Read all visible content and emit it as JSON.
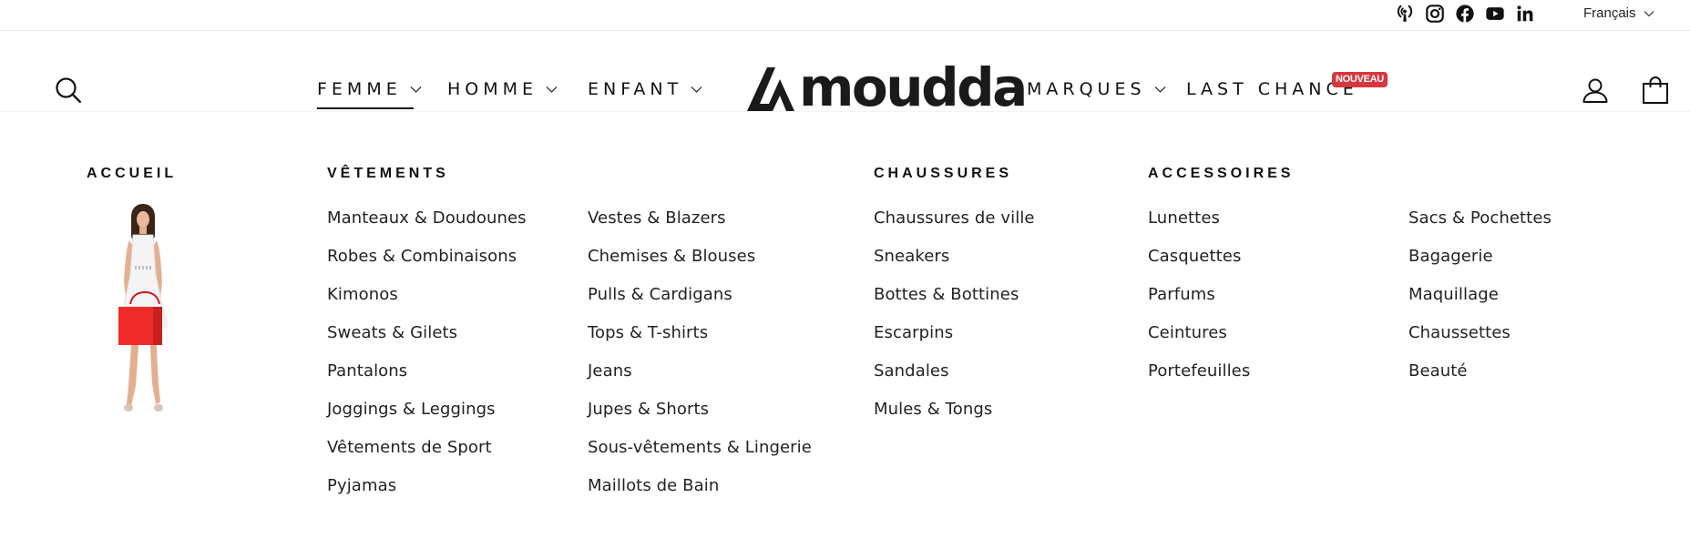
{
  "topbar": {
    "socials": [
      {
        "icon": "podcast-icon",
        "label": "Podcast"
      },
      {
        "icon": "instagram-icon",
        "label": "Instagram"
      },
      {
        "icon": "facebook-icon",
        "label": "Facebook"
      },
      {
        "icon": "youtube-icon",
        "label": "YouTube"
      },
      {
        "icon": "linkedin-icon",
        "label": "LinkedIn"
      }
    ],
    "language": "Français"
  },
  "header": {
    "logo_text": "moudda",
    "nav": [
      {
        "label": "FEMME",
        "active": true
      },
      {
        "label": "HOMME"
      },
      {
        "label": "ENFANT"
      },
      {
        "label": "MARQUES"
      },
      {
        "label": "LAST CHANCE",
        "badge": "NOUVEAU"
      }
    ],
    "icons": [
      "search-icon",
      "account-icon",
      "cart-icon"
    ]
  },
  "mega_menu": {
    "home": {
      "title": "ACCUEIL",
      "image": "woman-white-dress-red-bag"
    },
    "clothing": {
      "title": "VÊTEMENTS",
      "col1": [
        "Manteaux & Doudounes",
        "Robes & Combinaisons",
        "Kimonos",
        "Sweats & Gilets",
        "Pantalons",
        "Joggings & Leggings",
        "Vêtements de Sport",
        "Pyjamas"
      ],
      "col2": [
        "Vestes & Blazers",
        "Chemises & Blouses",
        "Pulls & Cardigans",
        "Tops & T-shirts",
        "Jeans",
        "Jupes & Shorts",
        "Sous-vêtements & Lingerie",
        "Maillots de Bain"
      ]
    },
    "shoes": {
      "title": "CHAUSSURES",
      "items": [
        "Chaussures de ville",
        "Sneakers",
        "Bottes & Bottines",
        "Escarpins",
        "Sandales",
        "Mules & Tongs"
      ]
    },
    "accessories": {
      "title": "ACCESSOIRES",
      "col1": [
        "Lunettes",
        "Casquettes",
        "Parfums",
        "Ceintures",
        "Portefeuilles"
      ],
      "col2": [
        "Sacs & Pochettes",
        "Bagagerie",
        "Maquillage",
        "Chaussettes",
        "Beauté"
      ]
    }
  },
  "colors": {
    "text": "#111111",
    "badge": "#d6373f",
    "accent_bag": "#f02a2a"
  }
}
